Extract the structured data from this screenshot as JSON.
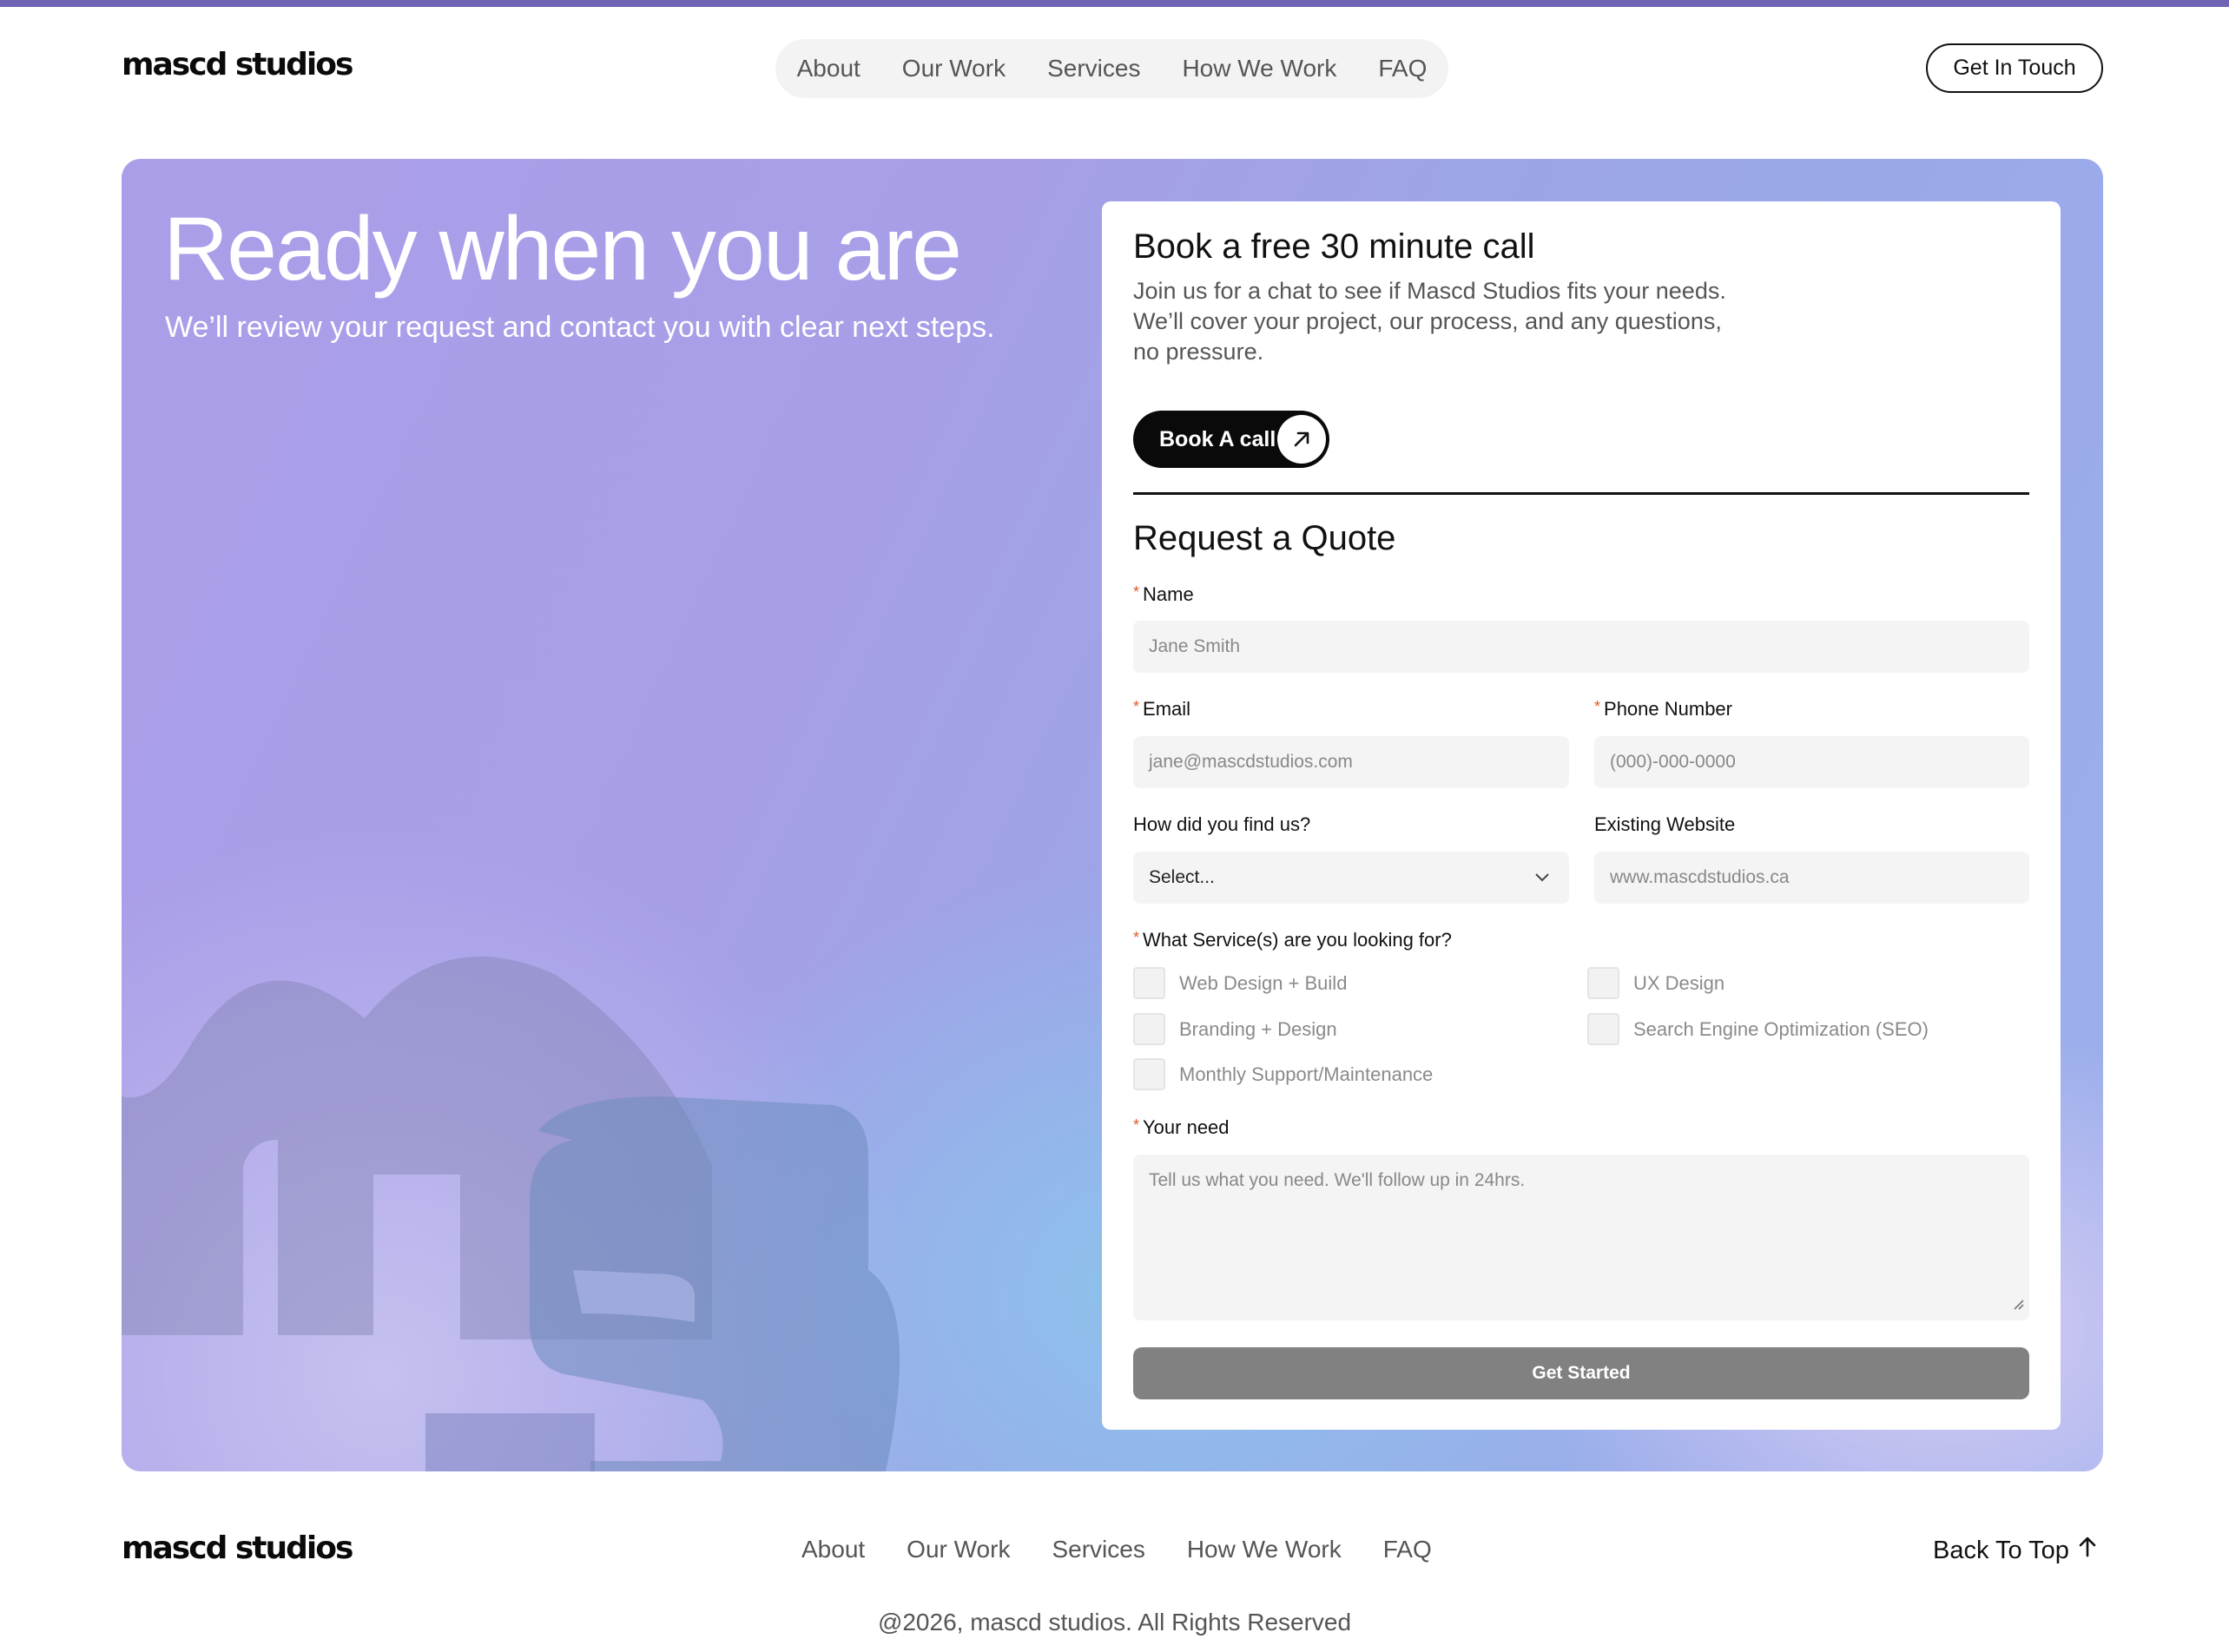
{
  "header": {
    "logo": "mascd studios",
    "nav": [
      "About",
      "Our Work",
      "Services",
      "How We Work",
      "FAQ"
    ],
    "cta": "Get In Touch"
  },
  "hero": {
    "title": "Ready when you are",
    "subtitle": "We’ll review your request and contact you with clear next steps."
  },
  "call": {
    "title": "Book a free 30 minute call",
    "description": "Join us for a chat to see if Mascd Studios fits your needs. We’ll cover your project, our process, and any questions, no pressure.",
    "button": "Book A call"
  },
  "quote": {
    "title": "Request a Quote",
    "name_label": "Name",
    "name_placeholder": "Jane Smith",
    "email_label": "Email",
    "email_placeholder": "jane@mascdstudios.com",
    "phone_label": "Phone Number",
    "phone_placeholder": "(000)-000-0000",
    "find_label": "How did you find us?",
    "find_value": "Select...",
    "website_label": "Existing Website",
    "website_placeholder": "www.mascdstudios.ca",
    "services_label": "What Service(s) are you looking for?",
    "services": [
      "Web Design + Build",
      "UX Design",
      "Branding + Design",
      "Search Engine Optimization (SEO)",
      "Monthly Support/Maintenance"
    ],
    "need_label": "Your need",
    "need_placeholder": "Tell us what you need. We'll follow up in 24hrs.",
    "submit": "Get Started",
    "required_mark": "*"
  },
  "footer": {
    "logo": "mascd studios",
    "nav": [
      "About",
      "Our Work",
      "Services",
      "How We Work",
      "FAQ"
    ],
    "back_to_top": "Back To Top",
    "copyright": "@2026, mascd studios. All Rights Reserved"
  },
  "colors": {
    "accent_line": "#6f63b5",
    "required": "#e0592f",
    "submit_bg": "#818181"
  }
}
